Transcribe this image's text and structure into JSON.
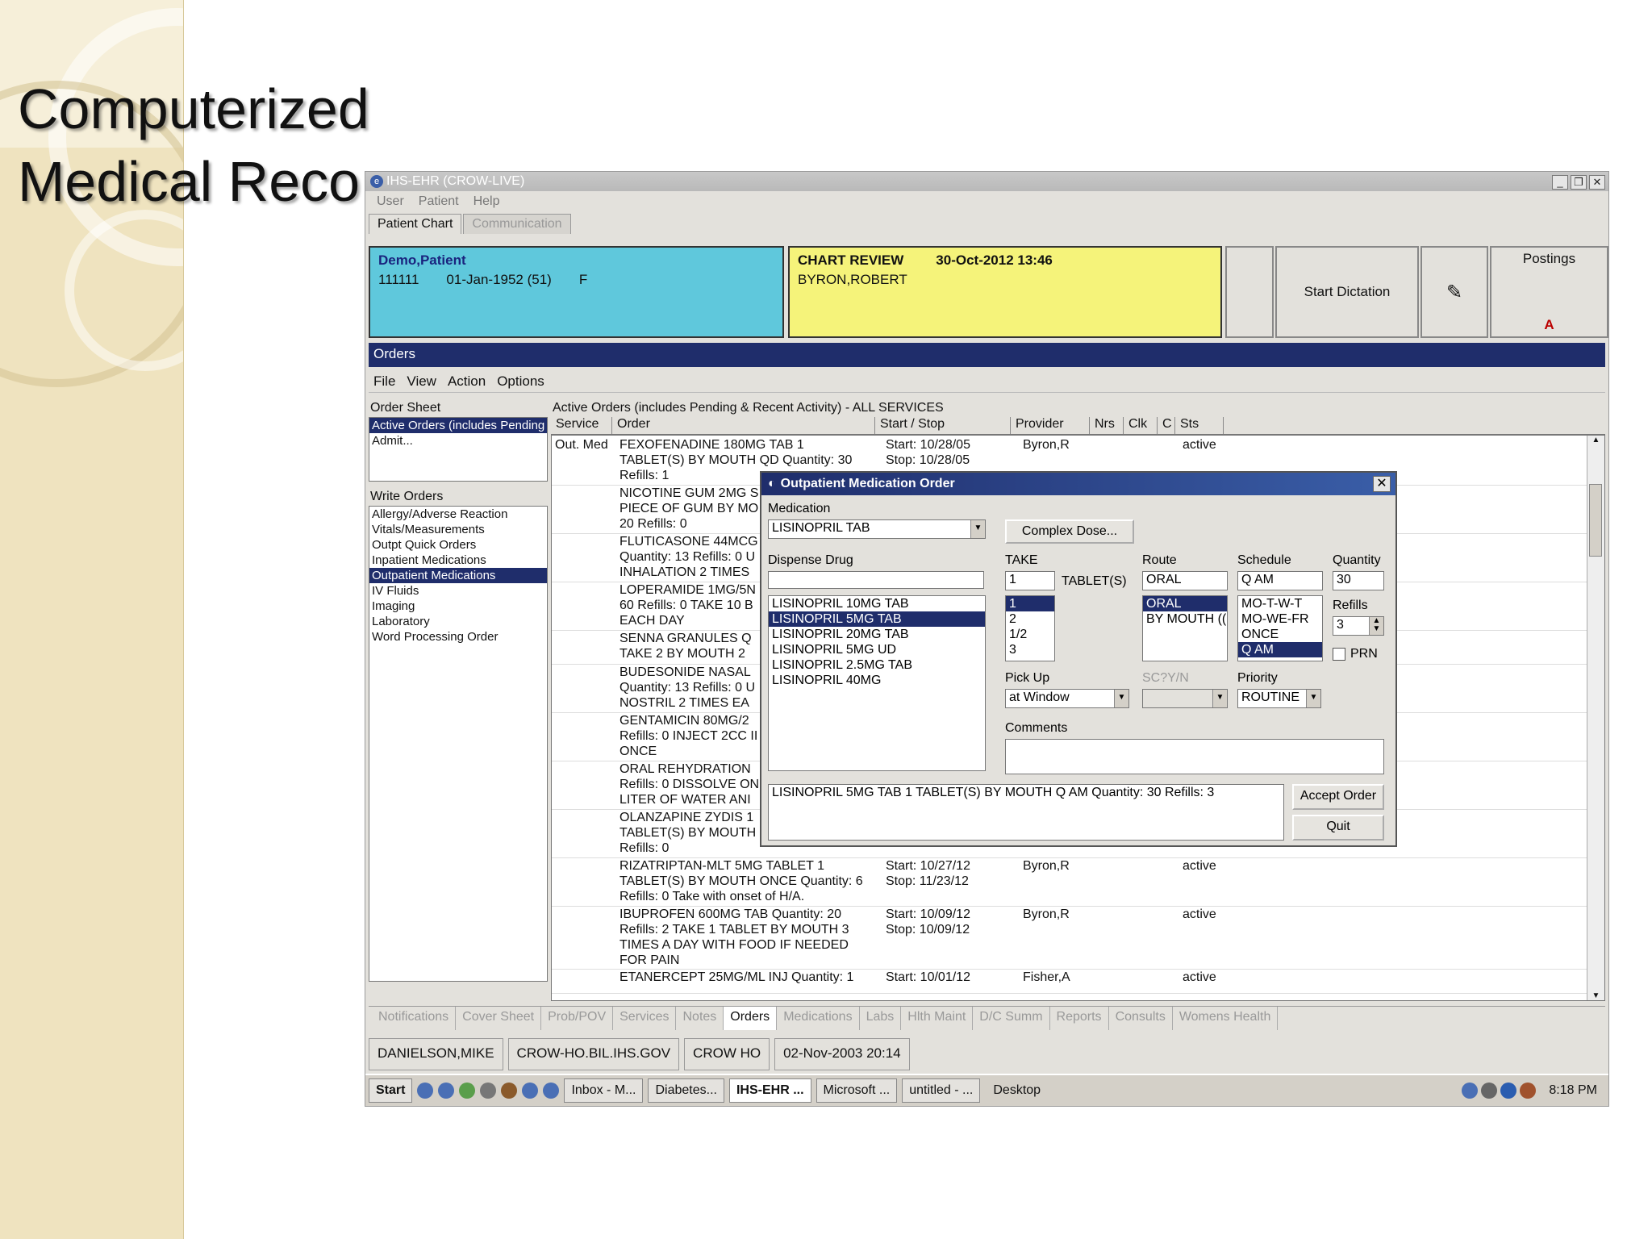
{
  "slide": {
    "title_line1": "Computerized",
    "title_line2": "Medical Reco"
  },
  "window": {
    "title": "IHS-EHR (CROW-LIVE)",
    "menu": [
      "User",
      "Patient",
      "Help"
    ],
    "tabs": [
      "Patient Chart",
      "Communication"
    ]
  },
  "patient": {
    "name": "Demo,Patient",
    "id": "111111",
    "dob": "01-Jan-1952 (51)",
    "sex": "F"
  },
  "chart": {
    "title": "CHART REVIEW",
    "datetime": "30-Oct-2012 13:46",
    "provider": "BYRON,ROBERT"
  },
  "header_buttons": {
    "dictation": "Start Dictation",
    "postings": "Postings",
    "postings_flag": "A"
  },
  "orders": {
    "bar_title": "Orders",
    "menu": [
      "File",
      "View",
      "Action",
      "Options"
    ],
    "order_sheet_label": "Order Sheet",
    "order_sheet_items": [
      "Active Orders (includes Pending",
      "Admit..."
    ],
    "write_orders_label": "Write Orders",
    "write_orders_items": [
      "Allergy/Adverse Reaction",
      "Vitals/Measurements",
      "Outpt Quick Orders",
      "Inpatient Medications",
      "Outpatient Medications",
      "IV Fluids",
      "Imaging",
      "Laboratory",
      "Word Processing Order"
    ],
    "grid_title": "Active Orders (includes Pending & Recent Activity) - ALL SERVICES",
    "columns": [
      "Service",
      "Order",
      "Start / Stop",
      "Provider",
      "Nrs",
      "Clk",
      "C",
      "Sts"
    ],
    "rows": [
      {
        "service": "Out. Med",
        "order": "FEXOFENADINE 180MG TAB 1\nTABLET(S) BY MOUTH QD Quantity: 30\nRefills: 1",
        "start": "Start: 10/28/05\nStop: 10/28/05",
        "provider": "Byron,R",
        "sts": "active"
      },
      {
        "service": "",
        "order": "NICOTINE GUM 2MG S\nPIECE OF GUM BY MO\n20 Refills: 0",
        "start": "",
        "provider": "",
        "sts": ""
      },
      {
        "service": "",
        "order": "FLUTICASONE 44MCG\nQuantity: 13 Refills: 0 U\nINHALATION 2 TIMES",
        "start": "",
        "provider": "",
        "sts": ""
      },
      {
        "service": "",
        "order": "LOPERAMIDE 1MG/5N\n60 Refills: 0 TAKE 10 B\nEACH DAY",
        "start": "",
        "provider": "",
        "sts": ""
      },
      {
        "service": "",
        "order": "SENNA GRANULES Q\nTAKE 2 BY MOUTH 2",
        "start": "",
        "provider": "",
        "sts": ""
      },
      {
        "service": "",
        "order": "BUDESONIDE NASAL\nQuantity: 13 Refills: 0 U\nNOSTRIL 2 TIMES EA",
        "start": "",
        "provider": "",
        "sts": ""
      },
      {
        "service": "",
        "order": "GENTAMICIN 80MG/2\nRefills: 0 INJECT 2CC II\nONCE",
        "start": "",
        "provider": "",
        "sts": ""
      },
      {
        "service": "",
        "order": "ORAL REHYDRATION\nRefills: 0 DISSOLVE ON\nLITER OF WATER ANI",
        "start": "",
        "provider": "",
        "sts": ""
      },
      {
        "service": "",
        "order": "OLANZAPINE ZYDIS 1\nTABLET(S) BY MOUTH\nRefills: 0",
        "start": "",
        "provider": "",
        "sts": ""
      },
      {
        "service": "",
        "order": "RIZATRIPTAN-MLT 5MG TABLET 1\nTABLET(S) BY MOUTH ONCE Quantity: 6\nRefills: 0 Take with onset of H/A.",
        "start": "Start: 10/27/12\nStop: 11/23/12",
        "provider": "Byron,R",
        "sts": "active"
      },
      {
        "service": "",
        "order": "IBUPROFEN 600MG TAB Quantity: 20\nRefills: 2 TAKE 1 TABLET BY MOUTH 3\nTIMES A DAY WITH FOOD IF NEEDED\nFOR PAIN",
        "start": "Start: 10/09/12\nStop: 10/09/12",
        "provider": "Byron,R",
        "sts": "active"
      },
      {
        "service": "",
        "order": "ETANERCEPT 25MG/ML INJ Quantity: 1",
        "start": "Start: 10/01/12",
        "provider": "Fisher,A",
        "sts": "active"
      }
    ]
  },
  "dialog": {
    "title": "Outpatient Medication Order",
    "medication_label": "Medication",
    "medication_value": "LISINOPRIL TAB",
    "complex_dose_button": "Complex Dose...",
    "dispense_label": "Dispense Drug",
    "dispense_value": "LISINOPRIL 5MG TAB",
    "dispense_options": [
      "LISINOPRIL 10MG TAB",
      "LISINOPRIL 5MG TAB",
      "LISINOPRIL 20MG TAB",
      "LISINOPRIL 5MG UD",
      "LISINOPRIL 2.5MG TAB",
      "LISINOPRIL 40MG"
    ],
    "take_label": "TAKE",
    "take_value": "1",
    "take_unit": "TABLET(S)",
    "take_options": [
      "1",
      "2",
      "1/2",
      "3"
    ],
    "route_label": "Route",
    "route_value": "ORAL",
    "route_options": [
      "ORAL",
      "BY MOUTH (("
    ],
    "schedule_label": "Schedule",
    "schedule_value": "Q AM",
    "schedule_options": [
      "MO-T-W-T",
      "MO-WE-FR",
      "ONCE",
      "Q AM"
    ],
    "quantity_label": "Quantity",
    "quantity_value": "30",
    "refills_label": "Refills",
    "refills_value": "3",
    "prn_label": "PRN",
    "pickup_label": "Pick Up",
    "pickup_value": "at Window",
    "sc_label": "SC?Y/N",
    "sc_value": "",
    "priority_label": "Priority",
    "priority_value": "ROUTINE",
    "comments_label": "Comments",
    "comments_value": "",
    "summary": "LISINOPRIL 5MG TAB  1 TABLET(S) BY MOUTH Q AM Quantity: 30 Refills: 3",
    "accept_button": "Accept Order",
    "quit_button": "Quit"
  },
  "bottom_tabs": [
    "Notifications",
    "Cover Sheet",
    "Prob/POV",
    "Services",
    "Notes",
    "Orders",
    "Medications",
    "Labs",
    "Hlth Maint",
    "D/C Summ",
    "Reports",
    "Consults",
    "Womens Health"
  ],
  "active_bottom_tab": "Orders",
  "status": {
    "user": "DANIELSON,MIKE",
    "server": "CROW-HO.BIL.IHS.GOV",
    "site": "CROW HO",
    "datetime": "02-Nov-2003 20:14"
  },
  "taskbar": {
    "start": "Start",
    "items": [
      "Inbox - M...",
      "Diabetes...",
      "IHS-EHR ...",
      "Microsoft ...",
      "untitled - ..."
    ],
    "desktop": "Desktop",
    "clock": "8:18 PM"
  }
}
